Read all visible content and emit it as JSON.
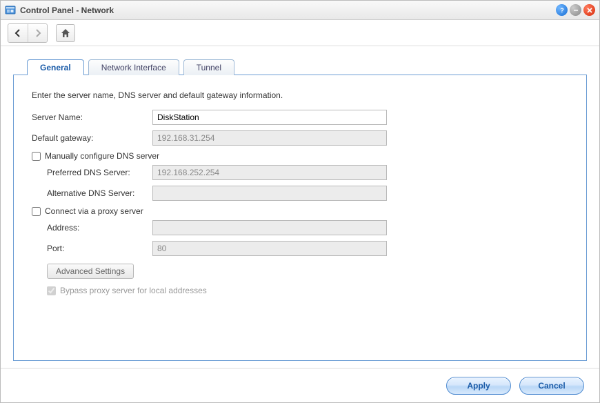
{
  "title": "Control Panel - Network",
  "tabs": [
    {
      "label": "General",
      "active": true
    },
    {
      "label": "Network Interface",
      "active": false
    },
    {
      "label": "Tunnel",
      "active": false
    }
  ],
  "form": {
    "description": "Enter the server name, DNS server and default gateway information.",
    "server_name_label": "Server Name:",
    "server_name_value": "DiskStation",
    "default_gateway_label": "Default gateway:",
    "default_gateway_value": "192.168.31.254",
    "manual_dns_label": "Manually configure DNS server",
    "preferred_dns_label": "Preferred DNS Server:",
    "preferred_dns_value": "192.168.252.254",
    "alternative_dns_label": "Alternative DNS Server:",
    "alternative_dns_value": "",
    "proxy_label": "Connect via a proxy server",
    "proxy_address_label": "Address:",
    "proxy_address_value": "",
    "proxy_port_label": "Port:",
    "proxy_port_value": "80",
    "advanced_btn": "Advanced Settings",
    "bypass_label": "Bypass proxy server for local addresses"
  },
  "footer": {
    "apply": "Apply",
    "cancel": "Cancel"
  }
}
